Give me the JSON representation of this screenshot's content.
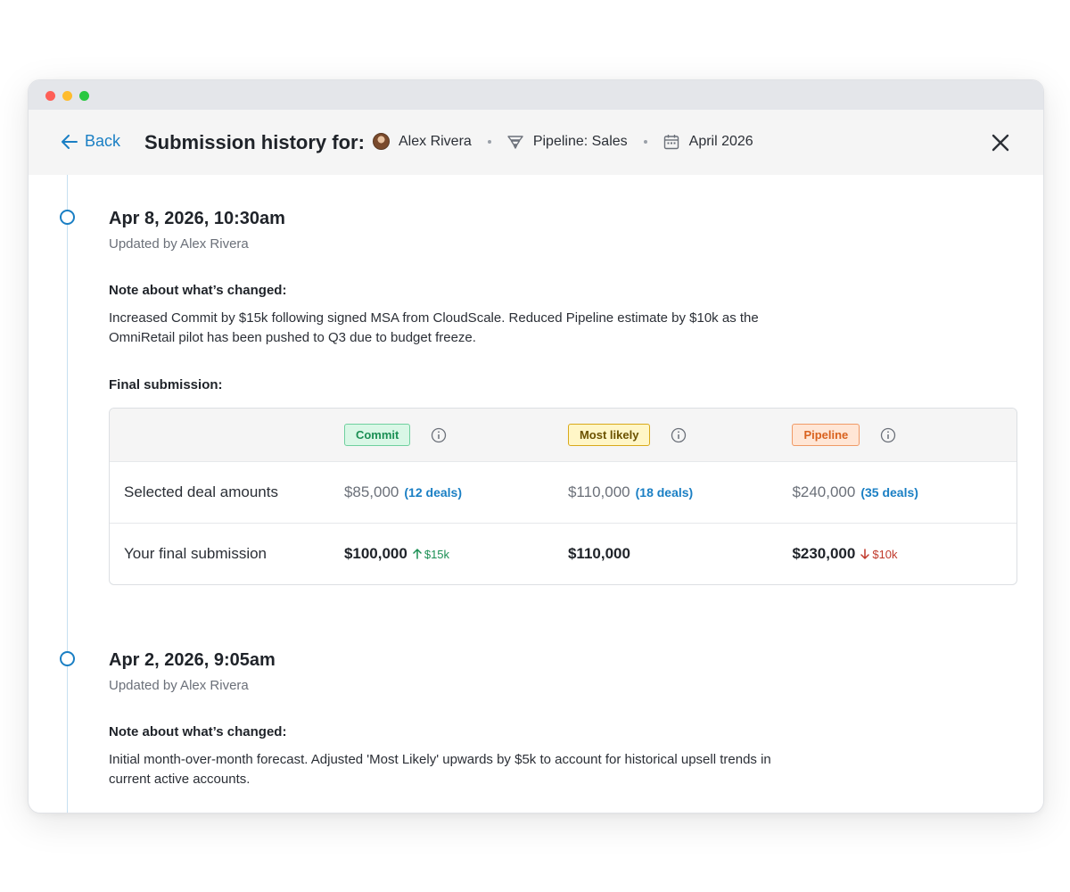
{
  "header": {
    "back_label": "Back",
    "title": "Submission history for:",
    "user": "Alex Rivera",
    "pipeline": "Pipeline: Sales",
    "period": "April 2026"
  },
  "entries": [
    {
      "date": "Apr 8, 2026, 10:30am",
      "updated_by": "Updated by Alex Rivera",
      "note_label": "Note about what’s changed:",
      "note": "Increased Commit by $15k following signed MSA from CloudScale. Reduced Pipeline estimate by $10k as the OmniRetail pilot has been pushed to Q3 due to budget freeze.",
      "final_label": "Final submission:",
      "table": {
        "columns": [
          {
            "label": "Commit",
            "color": "#1b8f54"
          },
          {
            "label": "Most likely",
            "color": "#6b5200"
          },
          {
            "label": "Pipeline",
            "color": "#d9621f"
          }
        ],
        "rows": [
          {
            "label": "Selected deal amounts",
            "cells": [
              {
                "amount": "$85,000",
                "deals": "(12 deals)"
              },
              {
                "amount": "$110,000",
                "deals": "(18 deals)"
              },
              {
                "amount": "$240,000",
                "deals": "(35 deals)"
              }
            ]
          },
          {
            "label": "Your final submission",
            "cells": [
              {
                "amount": "$100,000",
                "delta": "$15k",
                "direction": "up"
              },
              {
                "amount": "$110,000"
              },
              {
                "amount": "$230,000",
                "delta": "$10k",
                "direction": "down"
              }
            ]
          }
        ]
      }
    },
    {
      "date": "Apr 2, 2026, 9:05am",
      "updated_by": "Updated by Alex Rivera",
      "note_label": "Note about what’s changed:",
      "note": "Initial month-over-month forecast. Adjusted 'Most Likely' upwards by $5k to account for historical upsell trends in current active accounts."
    }
  ],
  "colors": {
    "accent": "#1a7fc4",
    "positive": "#1b8f54",
    "negative": "#c0392b"
  }
}
